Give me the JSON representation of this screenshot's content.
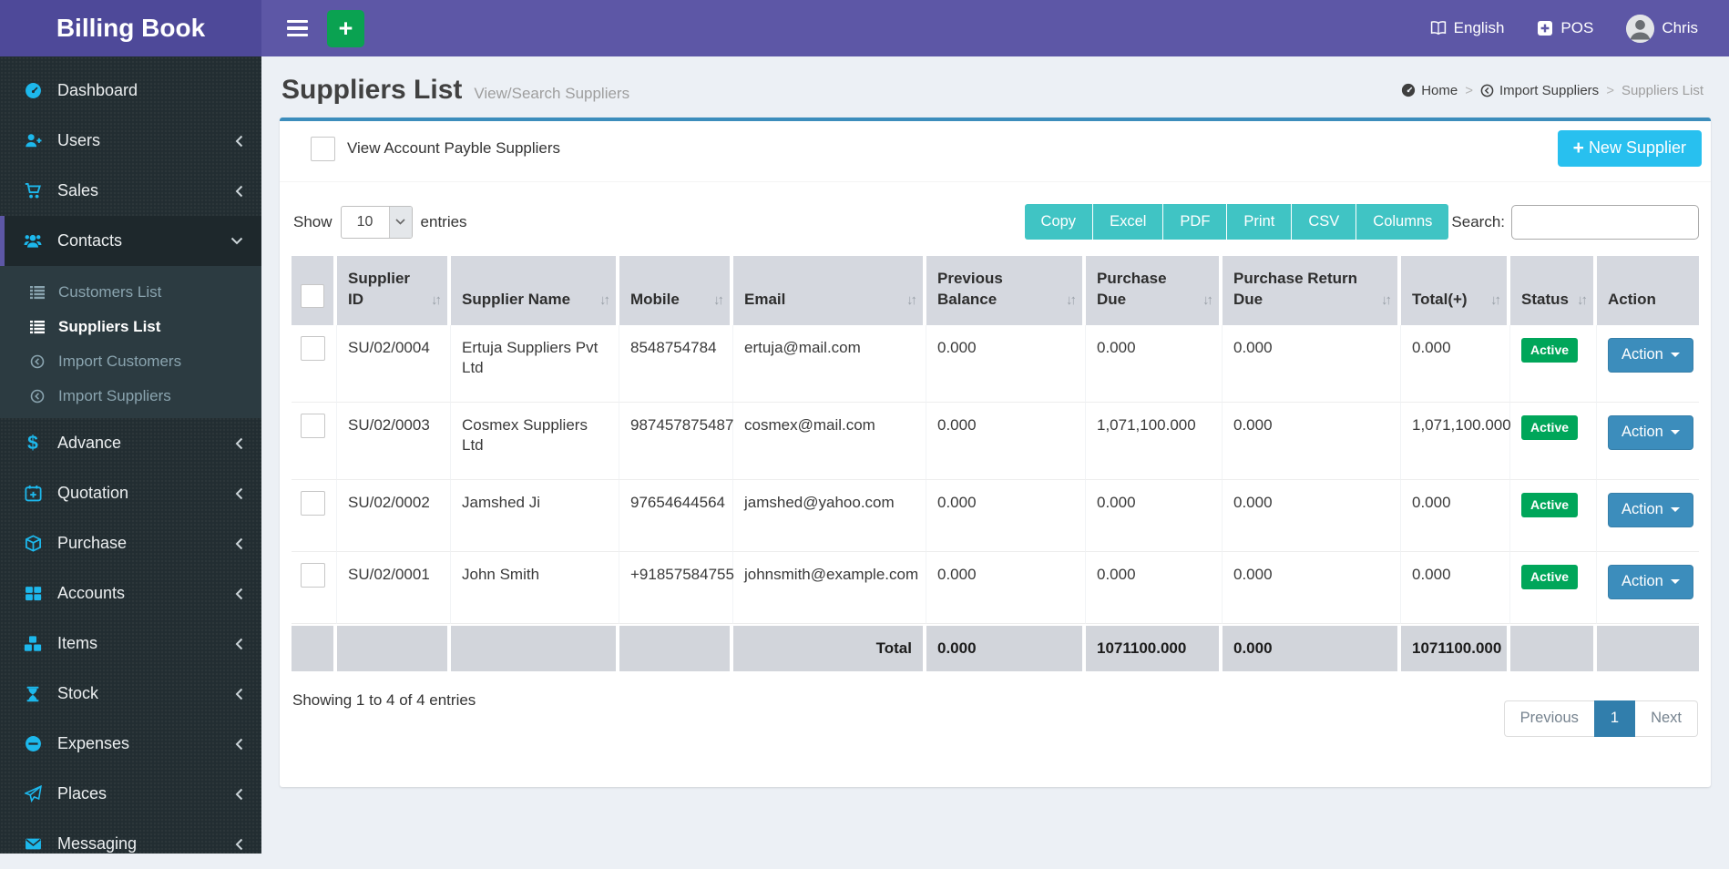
{
  "app": {
    "title": "Billing Book"
  },
  "topbar": {
    "language": "English",
    "pos": "POS",
    "user": "Chris"
  },
  "sidebar": {
    "items": [
      {
        "label": "Dashboard"
      },
      {
        "label": "Users",
        "collapsible": true
      },
      {
        "label": "Sales",
        "collapsible": true
      },
      {
        "label": "Contacts",
        "collapsible": true,
        "active": true,
        "expanded": true
      },
      {
        "label": "Advance",
        "collapsible": true
      },
      {
        "label": "Quotation",
        "collapsible": true
      },
      {
        "label": "Purchase",
        "collapsible": true
      },
      {
        "label": "Accounts",
        "collapsible": true
      },
      {
        "label": "Items",
        "collapsible": true
      },
      {
        "label": "Stock",
        "collapsible": true
      },
      {
        "label": "Expenses",
        "collapsible": true
      },
      {
        "label": "Places",
        "collapsible": true
      },
      {
        "label": "Messaging",
        "collapsible": true
      }
    ],
    "contacts_submenu": [
      {
        "label": "Customers List"
      },
      {
        "label": "Suppliers List",
        "active": true
      },
      {
        "label": "Import Customers"
      },
      {
        "label": "Import Suppliers"
      }
    ]
  },
  "page": {
    "title": "Suppliers List",
    "subtitle": "View/Search Suppliers",
    "breadcrumb_separator": ">",
    "breadcrumb": [
      {
        "label": "Home"
      },
      {
        "label": "Import Suppliers"
      },
      {
        "label": "Suppliers List"
      }
    ]
  },
  "card": {
    "payable_filter_label": "View Account Payble Suppliers",
    "new_supplier_label": "New Supplier",
    "show_label": "Show",
    "entries_label": "entries",
    "page_length": "10",
    "export_buttons": [
      {
        "label": "Copy"
      },
      {
        "label": "Excel"
      },
      {
        "label": "PDF"
      },
      {
        "label": "Print"
      },
      {
        "label": "CSV"
      },
      {
        "label": "Columns"
      }
    ],
    "search_label": "Search:",
    "table": {
      "action_label": "Action",
      "columns": [
        {
          "label": "Supplier ID",
          "sortable": true
        },
        {
          "label": "Supplier Name",
          "sortable": true
        },
        {
          "label": "Mobile",
          "sortable": true
        },
        {
          "label": "Email",
          "sortable": true
        },
        {
          "label": "Previous Balance",
          "sortable": true
        },
        {
          "label": "Purchase Due",
          "sortable": true
        },
        {
          "label": "Purchase Return Due",
          "sortable": true
        },
        {
          "label": "Total(+)",
          "sortable": true
        },
        {
          "label": "Status",
          "sortable": true
        },
        {
          "label": "Action",
          "sortable": false
        }
      ],
      "rows": [
        {
          "supplier_id": "SU/02/0004",
          "supplier_name": "Ertuja Suppliers Pvt Ltd",
          "mobile": "8548754784",
          "email": "ertuja@mail.com",
          "previous_balance": "0.000",
          "purchase_due": "0.000",
          "purchase_return_due": "0.000",
          "total": "0.000",
          "status": "Active"
        },
        {
          "supplier_id": "SU/02/0003",
          "supplier_name": "Cosmex Suppliers Ltd",
          "mobile": "987457875487",
          "email": "cosmex@mail.com",
          "previous_balance": "0.000",
          "purchase_due": "1,071,100.000",
          "purchase_return_due": "0.000",
          "total": "1,071,100.000",
          "status": "Active"
        },
        {
          "supplier_id": "SU/02/0002",
          "supplier_name": "Jamshed Ji",
          "mobile": "97654644564",
          "email": "jamshed@yahoo.com",
          "previous_balance": "0.000",
          "purchase_due": "0.000",
          "purchase_return_due": "0.000",
          "total": "0.000",
          "status": "Active"
        },
        {
          "supplier_id": "SU/02/0001",
          "supplier_name": "John Smith",
          "mobile": "+91857584755",
          "email": "johnsmith@example.com",
          "previous_balance": "0.000",
          "purchase_due": "0.000",
          "purchase_return_due": "0.000",
          "total": "0.000",
          "status": "Active"
        }
      ],
      "total": {
        "label": "Total",
        "previous_balance": "0.000",
        "purchase_due": "1071100.000",
        "purchase_return_due": "0.000",
        "total": "1071100.000"
      }
    },
    "footer": {
      "showing": "Showing 1 to 4 of 4 entries",
      "pagination": {
        "previous": "Previous",
        "current": "1",
        "next": "Next"
      }
    }
  },
  "colors": {
    "navbar": "#5d57a6",
    "logo_bg": "#4e4999",
    "sidebar_bg": "#222d32",
    "sidebar_icon_accent": "#1db8ec",
    "card_top_border": "#3c8dbc",
    "new_supplier_button": "#28c0ef",
    "export_button": "#40c4c4",
    "add_button_green": "#0aa251",
    "status_active_badge": "#00a65a",
    "action_button": "#3c8dbc",
    "pagination_active": "#317eac"
  }
}
